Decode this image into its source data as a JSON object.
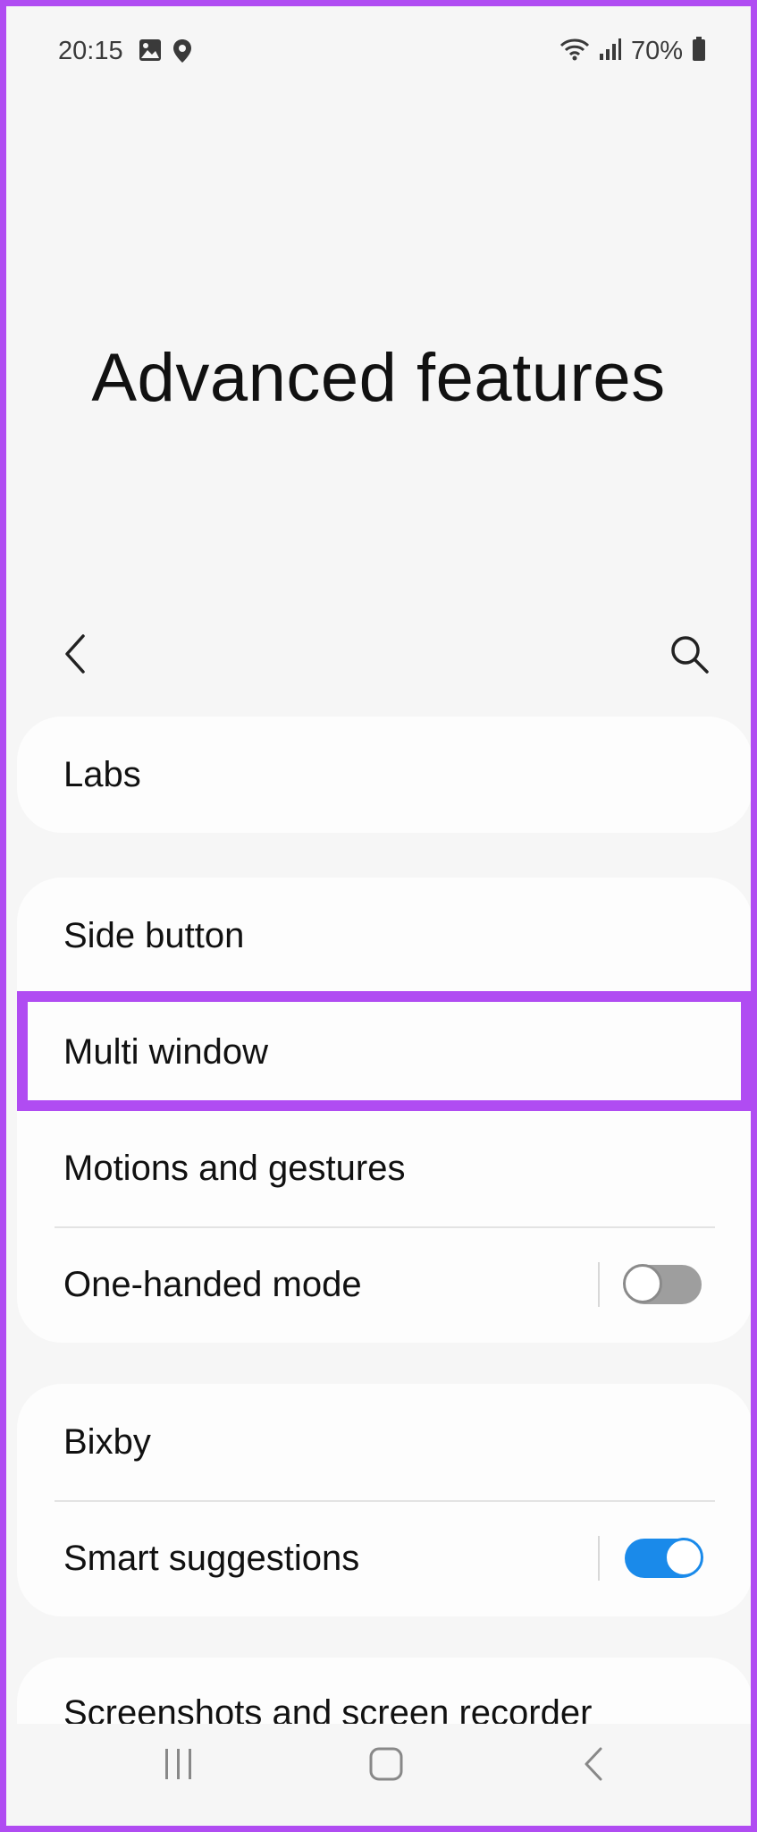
{
  "status_bar": {
    "time": "20:15",
    "battery_text": "70%",
    "icons": [
      "gallery-icon",
      "location-icon",
      "wifi-icon",
      "signal-icon",
      "battery-icon"
    ]
  },
  "header": {
    "title": "Advanced features"
  },
  "toolbar": {
    "back_icon": "chevron-left-icon",
    "search_icon": "search-icon"
  },
  "sections": [
    {
      "items": [
        {
          "label": "Labs"
        }
      ]
    },
    {
      "items": [
        {
          "label": "Side button"
        },
        {
          "label": "Multi window",
          "highlighted": true
        },
        {
          "label": "Motions and gestures"
        },
        {
          "label": "One-handed mode",
          "toggle": "off"
        }
      ]
    },
    {
      "items": [
        {
          "label": "Bixby"
        },
        {
          "label": "Smart suggestions",
          "toggle": "on"
        }
      ]
    },
    {
      "items": [
        {
          "label": "Screenshots and screen recorder"
        }
      ]
    }
  ],
  "colors": {
    "highlight": "#b04cf2",
    "toggle_on": "#1a8aea",
    "toggle_off": "#9e9e9e"
  },
  "nav_bar": {
    "icons": [
      "recent-apps-icon",
      "home-icon",
      "back-icon"
    ]
  }
}
